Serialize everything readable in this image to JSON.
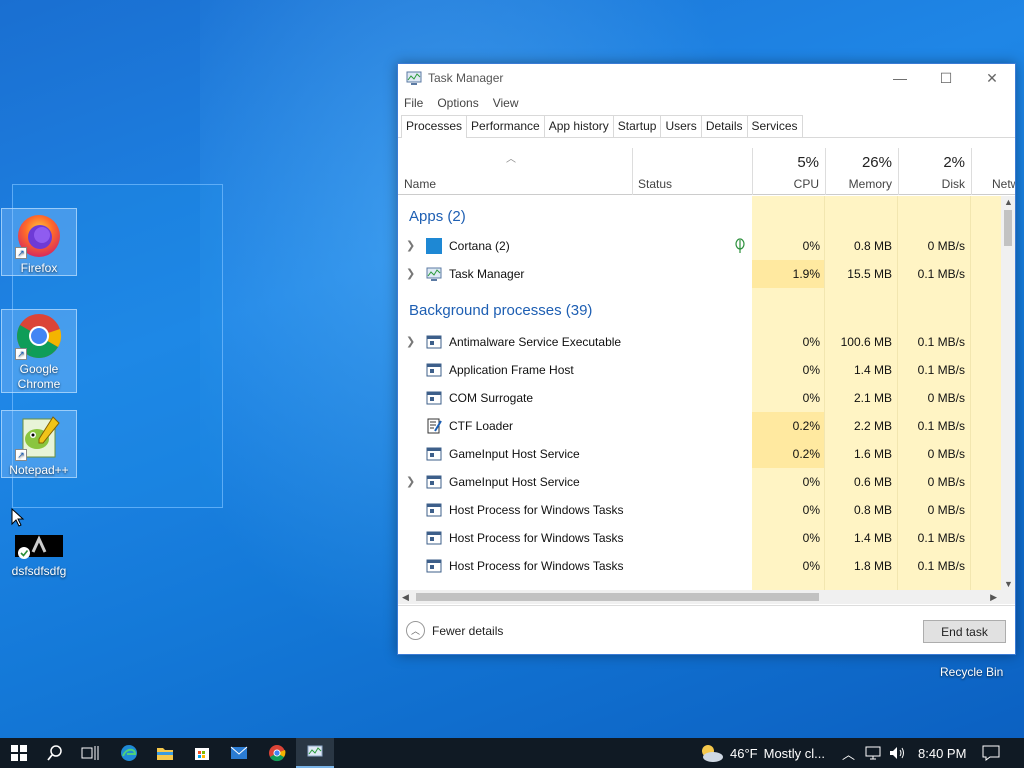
{
  "desktop": {
    "icons": [
      {
        "label": "Firefox"
      },
      {
        "label": "Google Chrome"
      },
      {
        "label": "Notepad++"
      },
      {
        "label": "dsfsdfsdfg"
      }
    ],
    "recycle_bin": "Recycle Bin"
  },
  "task_manager": {
    "title": "Task Manager",
    "window_controls": {
      "minimize": "—",
      "maximize": "☐",
      "close": "✕"
    },
    "menu": [
      "File",
      "Options",
      "View"
    ],
    "tabs": [
      "Processes",
      "Performance",
      "App history",
      "Startup",
      "Users",
      "Details",
      "Services"
    ],
    "active_tab": "Processes",
    "columns": {
      "name": "Name",
      "status": "Status",
      "cpu": {
        "percent": "5%",
        "label": "CPU"
      },
      "memory": {
        "percent": "26%",
        "label": "Memory"
      },
      "disk": {
        "percent": "2%",
        "label": "Disk"
      },
      "network": {
        "label": "Netw"
      }
    },
    "groups": {
      "apps": "Apps (2)",
      "background": "Background processes (39)"
    },
    "apps": [
      {
        "name": "Cortana (2)",
        "cpu": "0%",
        "memory": "0.8 MB",
        "disk": "0 MB/s",
        "expand": true,
        "icon": "cortana-icon"
      },
      {
        "name": "Task Manager",
        "cpu": "1.9%",
        "memory": "15.5 MB",
        "disk": "0.1 MB/s",
        "expand": true,
        "icon": "task-manager-icon"
      }
    ],
    "background": [
      {
        "name": "Antimalware Service Executable",
        "cpu": "0%",
        "memory": "100.6 MB",
        "disk": "0.1 MB/s",
        "expand": true
      },
      {
        "name": "Application Frame Host",
        "cpu": "0%",
        "memory": "1.4 MB",
        "disk": "0.1 MB/s",
        "expand": false
      },
      {
        "name": "COM Surrogate",
        "cpu": "0%",
        "memory": "2.1 MB",
        "disk": "0 MB/s",
        "expand": false
      },
      {
        "name": "CTF Loader",
        "cpu": "0.2%",
        "memory": "2.2 MB",
        "disk": "0.1 MB/s",
        "expand": false
      },
      {
        "name": "GameInput Host Service",
        "cpu": "0.2%",
        "memory": "1.6 MB",
        "disk": "0 MB/s",
        "expand": false
      },
      {
        "name": "GameInput Host Service",
        "cpu": "0%",
        "memory": "0.6 MB",
        "disk": "0 MB/s",
        "expand": true
      },
      {
        "name": "Host Process for Windows Tasks",
        "cpu": "0%",
        "memory": "0.8 MB",
        "disk": "0 MB/s",
        "expand": false
      },
      {
        "name": "Host Process for Windows Tasks",
        "cpu": "0%",
        "memory": "1.4 MB",
        "disk": "0.1 MB/s",
        "expand": false
      },
      {
        "name": "Host Process for Windows Tasks",
        "cpu": "0%",
        "memory": "1.8 MB",
        "disk": "0.1 MB/s",
        "expand": false
      }
    ],
    "footer": {
      "fewer_details": "Fewer details",
      "end_task": "End task"
    }
  },
  "taskbar": {
    "weather_temp": "46°F",
    "weather_desc": "Mostly cl...",
    "clock": "8:40 PM"
  },
  "colors": {
    "accent": "#1e5fb3",
    "heat_light": "#fff4c4",
    "heat_medium": "#ffe9a0",
    "taskbar": "#101a24"
  }
}
